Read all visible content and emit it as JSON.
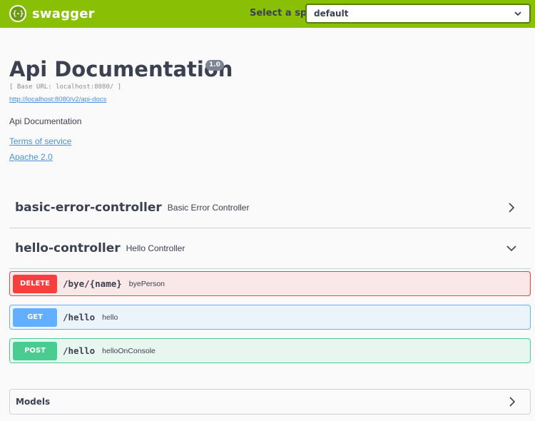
{
  "topbar": {
    "logo_glyph": "{-}",
    "logo_text": "swagger",
    "spec_label": "Select a spec",
    "spec_selected": "default",
    "brand_color": "#89bf04"
  },
  "info": {
    "title": "Api Documentation",
    "version": "1.0",
    "base_url": "[ Base URL: localhost:8080/ ]",
    "docs_link": "http://localhost:8080/v2/api-docs",
    "description": "Api Documentation",
    "terms_of_service": "Terms of service",
    "license": "Apache 2.0"
  },
  "tags": [
    {
      "name": "basic-error-controller",
      "description": "Basic Error Controller",
      "expanded": false,
      "arrow_icon": "chevron-right-icon"
    },
    {
      "name": "hello-controller",
      "description": "Hello Controller",
      "expanded": true,
      "arrow_icon": "chevron-down-icon"
    }
  ],
  "operations": [
    {
      "method": "DELETE",
      "path": "/bye/{name}",
      "summary": "byePerson",
      "color": "#f93e3e"
    },
    {
      "method": "GET",
      "path": "/hello",
      "summary": "hello",
      "color": "#61affe"
    },
    {
      "method": "POST",
      "path": "/hello",
      "summary": "helloOnConsole",
      "color": "#49cc90"
    }
  ],
  "models": {
    "label": "Models",
    "arrow_icon": "chevron-right-icon"
  }
}
